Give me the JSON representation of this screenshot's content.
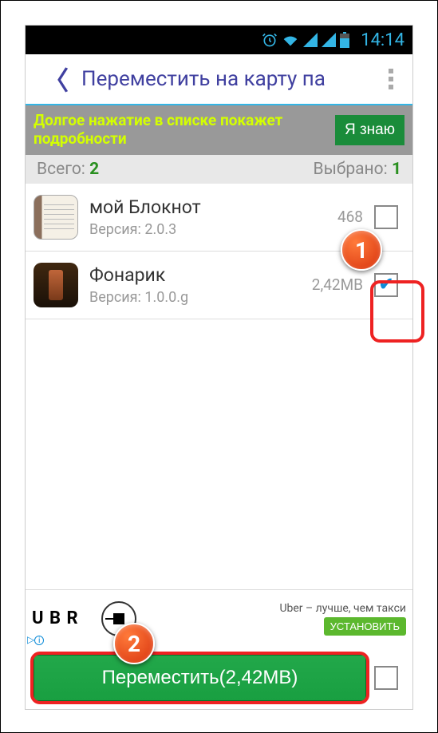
{
  "status": {
    "time": "14:14"
  },
  "header": {
    "title": "Переместить на карту па"
  },
  "hint": {
    "text": "Долгое нажатие в списке покажет подробности",
    "button": "Я знаю"
  },
  "stats": {
    "total_label": "Всего: ",
    "total_value": "2",
    "selected_label": "Выбрано: ",
    "selected_value": "1"
  },
  "apps": [
    {
      "name": "мой Блокнот",
      "version": "Версия: 2.0.3",
      "size": "468",
      "checked": false,
      "icon": "notepad"
    },
    {
      "name": "Фонарик",
      "version": "Версия: 1.0.0.g",
      "size": "2,42MB",
      "checked": true,
      "icon": "flashlight"
    }
  ],
  "ad": {
    "brand": "U B  R",
    "title": "Uber – лучше, чем такси",
    "install": "УСТАНОВИТЬ",
    "badge": "▷"
  },
  "action": {
    "move": "Переместить(2,42MB)",
    "select_all_checked": false
  },
  "callouts": {
    "c1": "1",
    "c2": "2"
  }
}
